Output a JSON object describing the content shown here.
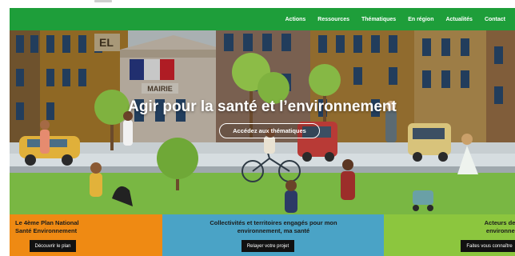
{
  "nav": {
    "items": [
      {
        "label": "Actions"
      },
      {
        "label": "Ressources"
      },
      {
        "label": "Thématiques"
      },
      {
        "label": "En région"
      },
      {
        "label": "Actualités"
      },
      {
        "label": "Contact"
      }
    ]
  },
  "hero": {
    "title": "Agir pour la santé et l’environnement",
    "button_label": "Accédez aux thématiques",
    "building_sign": "MAIRIE",
    "building_letters": "EL"
  },
  "tiles": [
    {
      "text_line1": "Le 4ème Plan National",
      "text_line2": "Santé Environnement",
      "button_label": "Découvrir le plan",
      "color": "#ef8a13"
    },
    {
      "text_line1": "Collectivités et territoires engagés pour mon",
      "text_line2": "environnement, ma santé",
      "button_label": "Relayer votre projet",
      "color": "#4aa3c6"
    },
    {
      "text_line1": "Acteurs de la santé",
      "text_line2": "environnementale",
      "button_label": "Faites vous connaître",
      "color": "#8cc63e"
    }
  ],
  "colors": {
    "nav_green": "#1e9e3a"
  }
}
